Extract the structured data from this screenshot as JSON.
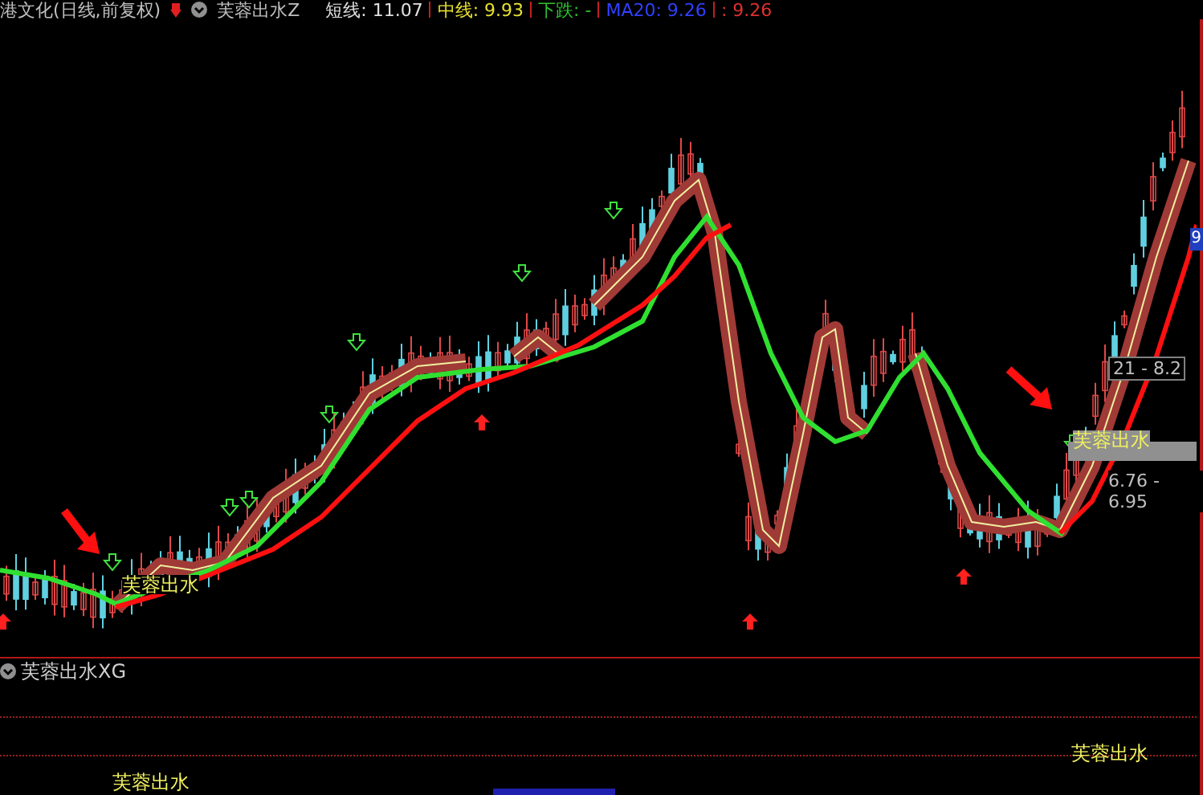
{
  "header": {
    "title": "港文化(日线,前复权)",
    "indicator": "芙蓉出水Z",
    "values": [
      {
        "text": "短线: 11.07",
        "color": "#e0e0e0"
      },
      {
        "text": "中线: 9.93",
        "color": "#e8e030"
      },
      {
        "text": "下跌: -",
        "color": "#30c030"
      },
      {
        "text": "MA20: 9.26",
        "color": "#3040ff"
      },
      {
        "text": ": 9.26",
        "color": "#e03030"
      }
    ]
  },
  "chart": {
    "signals": [
      {
        "text": "芙蓉出水",
        "highlighted": false
      },
      {
        "text": "芙蓉出水",
        "highlighted": true
      }
    ],
    "price_labels": [
      "21 - 8.2",
      "6.76 - 6.95"
    ],
    "edge_label": "9"
  },
  "sub_panel": {
    "title": "芙蓉出水XG",
    "signals": [
      "芙蓉出水",
      "芙蓉出水"
    ]
  }
}
